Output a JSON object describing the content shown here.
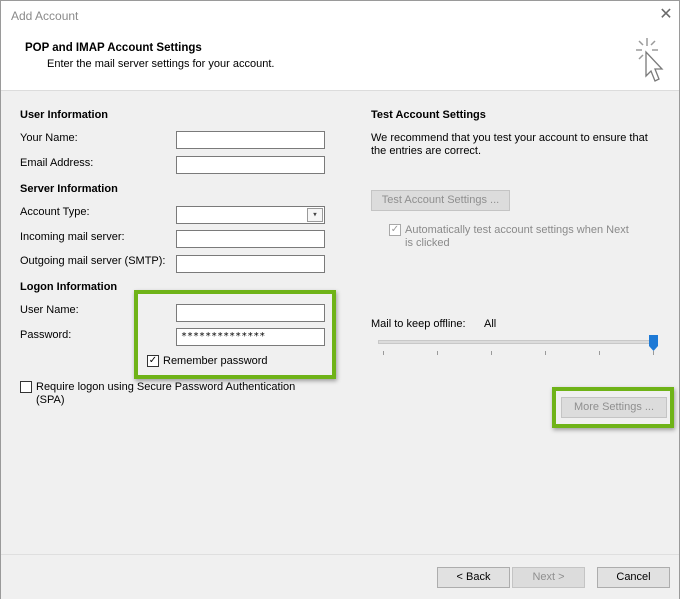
{
  "window": {
    "title": "Add Account",
    "close_glyph": "✕"
  },
  "header": {
    "title": "POP and IMAP Account Settings",
    "subtitle": "Enter the mail server settings for your account.",
    "icon": "cursor-sparkle-icon"
  },
  "user_info": {
    "heading": "User Information",
    "your_name_label": "Your Name:",
    "your_name_value": "",
    "email_label": "Email Address:",
    "email_value": ""
  },
  "server_info": {
    "heading": "Server Information",
    "account_type_label": "Account Type:",
    "account_type_value": "",
    "incoming_label": "Incoming mail server:",
    "incoming_value": "",
    "outgoing_label": "Outgoing mail server (SMTP):",
    "outgoing_value": ""
  },
  "logon_info": {
    "heading": "Logon Information",
    "username_label": "User Name:",
    "username_value": "",
    "password_label": "Password:",
    "password_value": "**************",
    "remember_label": "Remember password",
    "remember_checked": true,
    "spa_label_line1": "Require logon using Secure Password Authentication",
    "spa_label_line2": "(SPA)",
    "spa_checked": false
  },
  "test_settings": {
    "heading": "Test Account Settings",
    "desc_line1": "We recommend that you test your account to ensure that",
    "desc_line2": "the entries are correct.",
    "test_button_label": "Test Account Settings ...",
    "auto_test_line1": "Automatically test account settings when Next",
    "auto_test_line2": "is clicked",
    "auto_test_checked": true
  },
  "offline": {
    "label": "Mail to keep offline:",
    "value": "All",
    "slider_level": 1.0
  },
  "more_settings_label": "More Settings ...",
  "footer": {
    "back_label": "< Back",
    "next_label": "Next >",
    "cancel_label": "Cancel"
  },
  "colors": {
    "highlight": "#6fb318",
    "slider_thumb": "#1e7ad6"
  }
}
